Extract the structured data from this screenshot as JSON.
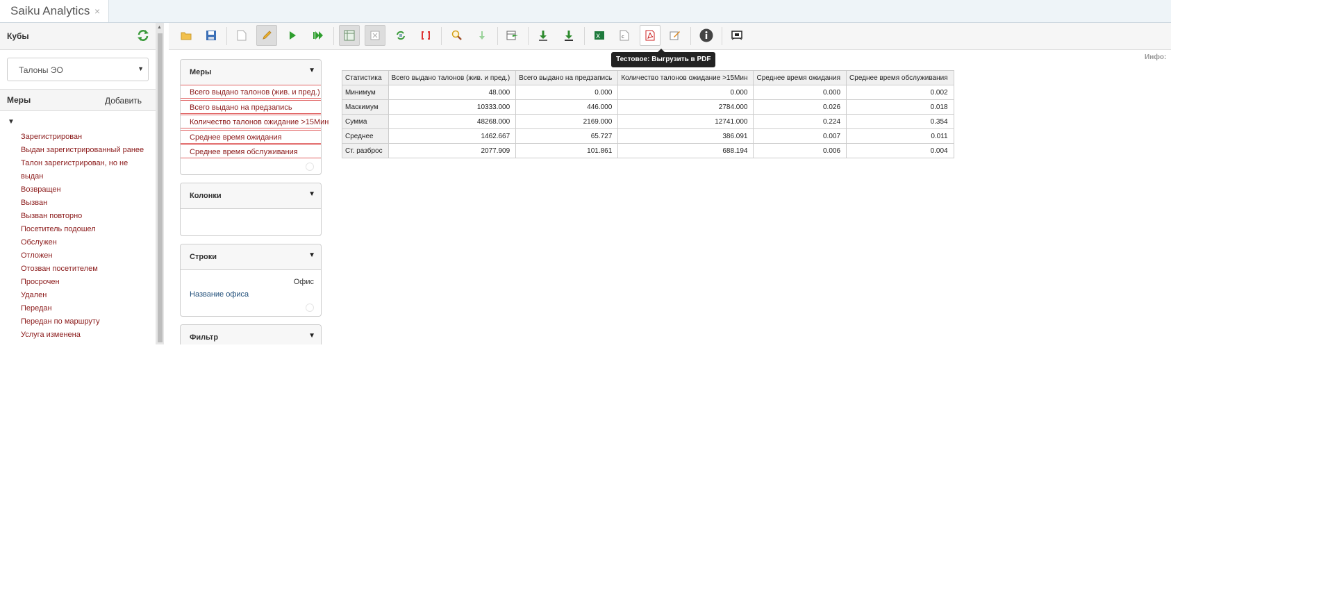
{
  "tab": {
    "title": "Saiku Analytics",
    "close": "×"
  },
  "left": {
    "cubes_title": "Кубы",
    "cube_selected": "Талоны ЭО",
    "measures_title": "Меры",
    "add_label": "Добавить",
    "measures": [
      "Зарегистрирован",
      "Выдан зарегистрированный ранее",
      "Талон зарегистрирован, но не выдан",
      "Возвращен",
      "Вызван",
      "Вызван повторно",
      "Посетитель подошел",
      "Обслужен",
      "Отложен",
      "Отозван посетителем",
      "Просрочен",
      "Удален",
      "Передан",
      "Передан по маршруту",
      "Услуга изменена"
    ]
  },
  "toolbar": {
    "tooltip": "Тестовое: Выгрузить в PDF",
    "info_label": "Инфо:"
  },
  "panels": {
    "measures": {
      "title": "Меры",
      "items": [
        "Всего выдано талонов (жив. и пред.)",
        "Всего выдано на предзапись",
        "Количество талонов ожидание >15Мин",
        "Среднее время ожидания",
        "Среднее время обслуживания"
      ]
    },
    "columns": {
      "title": "Колонки"
    },
    "rows": {
      "title": "Строки",
      "hierarchy": "Офис",
      "level": "Название офиса"
    },
    "filter": {
      "title": "Фильтр"
    }
  },
  "table": {
    "headers": [
      "Статистика",
      "Всего выдано талонов (жив. и пред.)",
      "Всего выдано на предзапись",
      "Количество талонов ожидание >15Мин",
      "Среднее время ожидания",
      "Среднее время обслуживания"
    ],
    "rows": [
      [
        "Минимум",
        "48.000",
        "0.000",
        "0.000",
        "0.000",
        "0.002"
      ],
      [
        "Маскимум",
        "10333.000",
        "446.000",
        "2784.000",
        "0.026",
        "0.018"
      ],
      [
        "Сумма",
        "48268.000",
        "2169.000",
        "12741.000",
        "0.224",
        "0.354"
      ],
      [
        "Среднее",
        "1462.667",
        "65.727",
        "386.091",
        "0.007",
        "0.011"
      ],
      [
        "Ст. разброс",
        "2077.909",
        "101.861",
        "688.194",
        "0.006",
        "0.004"
      ]
    ]
  },
  "colors": {
    "measure_text": "#8b1a1a",
    "accent_border": "#e06060",
    "link": "#1f4e79"
  }
}
